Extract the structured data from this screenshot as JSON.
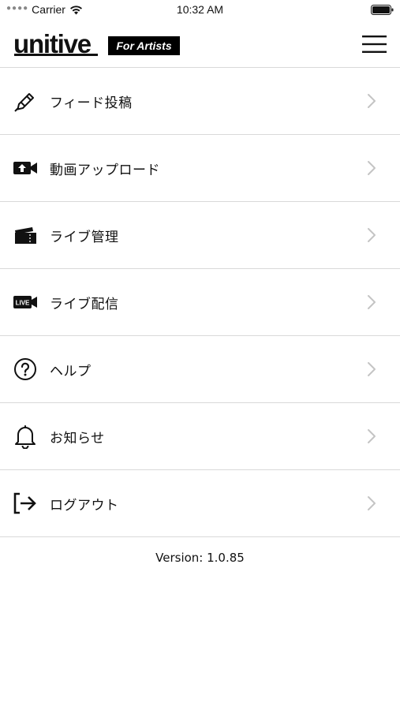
{
  "status_bar": {
    "carrier": "Carrier",
    "time": "10:32 AM"
  },
  "header": {
    "logo_text": "unitive",
    "badge_text": "For Artists",
    "menu_icon": "hamburger-menu-icon"
  },
  "menu": {
    "items": [
      {
        "label": "フィード投稿",
        "icon": "pencil-icon"
      },
      {
        "label": "動画アップロード",
        "icon": "video-upload-icon"
      },
      {
        "label": "ライブ管理",
        "icon": "ticket-icon"
      },
      {
        "label": "ライブ配信",
        "icon": "live-camera-icon"
      },
      {
        "label": "ヘルプ",
        "icon": "help-circle-icon"
      },
      {
        "label": "お知らせ",
        "icon": "bell-icon"
      },
      {
        "label": "ログアウト",
        "icon": "logout-icon"
      }
    ],
    "chevron_icon": "chevron-right-icon"
  },
  "footer": {
    "version": "Version: 1.0.85"
  },
  "colors": {
    "text": "#111111",
    "divider": "#d9d9d9",
    "chevron": "#c4c4c4",
    "badge_bg": "#000000"
  }
}
